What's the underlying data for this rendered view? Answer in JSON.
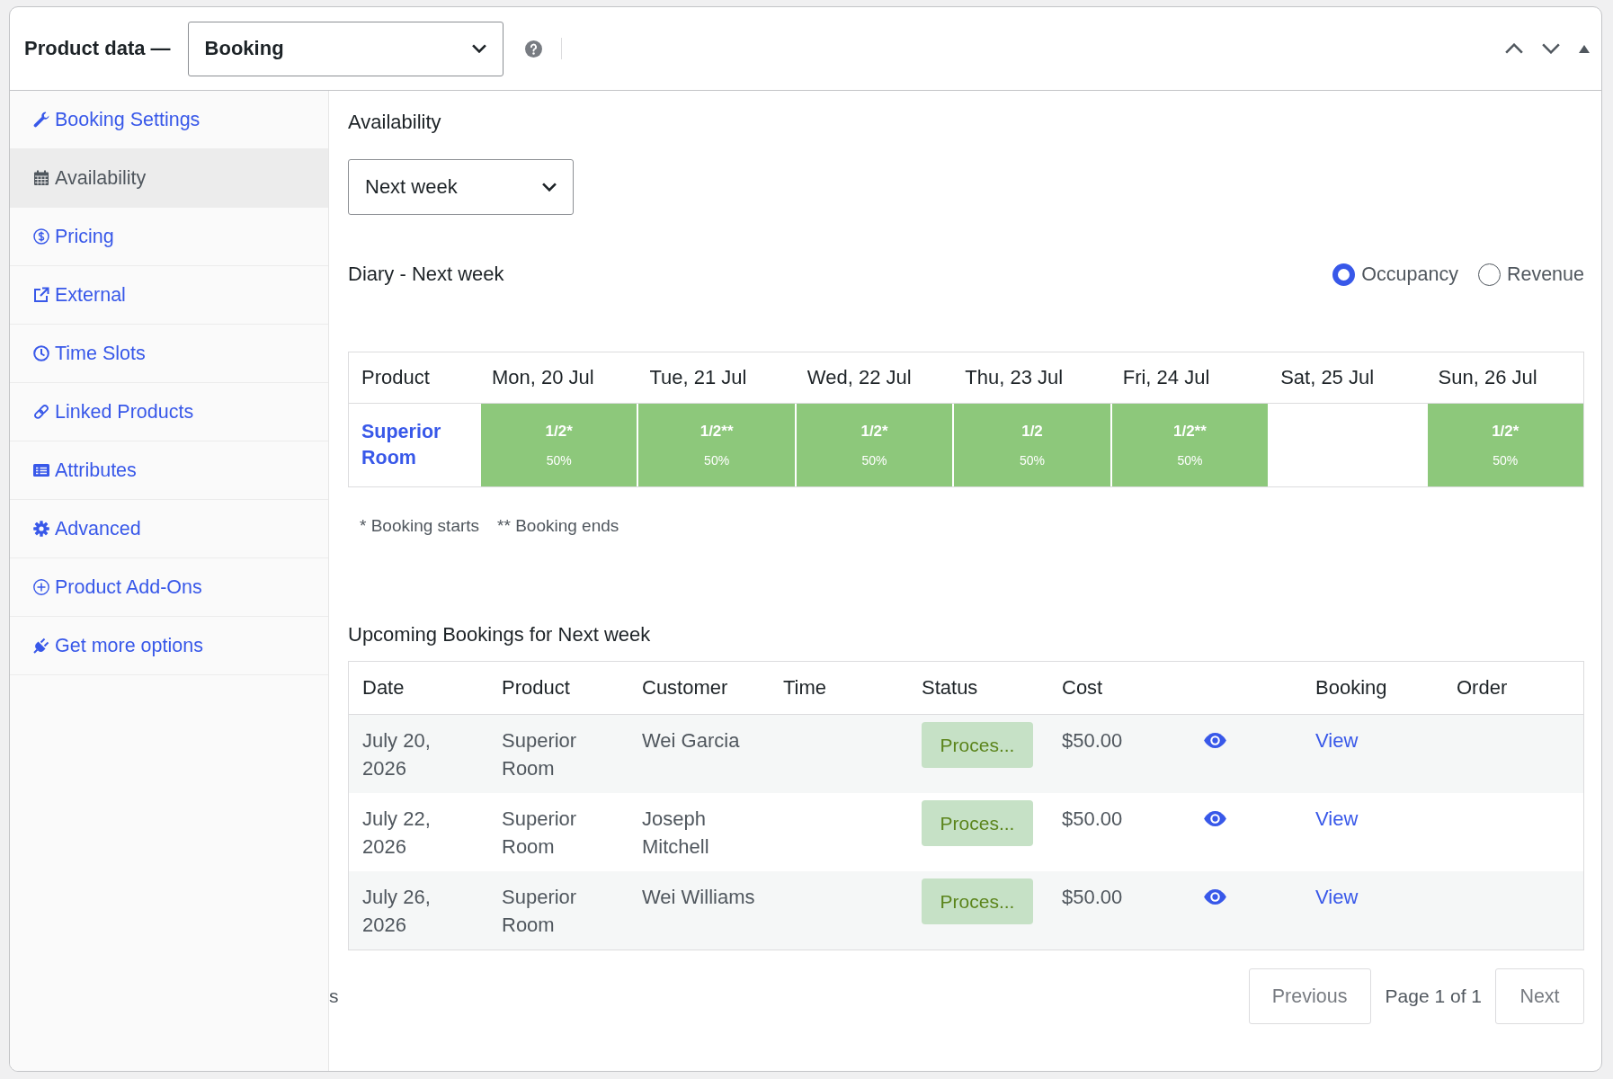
{
  "panel": {
    "title": "Product data —",
    "product_type_select": {
      "value": "Booking"
    }
  },
  "sidebar": {
    "items": [
      {
        "label": "Booking Settings",
        "selected": false
      },
      {
        "label": "Availability",
        "selected": true
      },
      {
        "label": "Pricing",
        "selected": false
      },
      {
        "label": "External",
        "selected": false
      },
      {
        "label": "Time Slots",
        "selected": false
      },
      {
        "label": "Linked Products",
        "selected": false
      },
      {
        "label": "Attributes",
        "selected": false
      },
      {
        "label": "Advanced",
        "selected": false
      },
      {
        "label": "Product Add-Ons",
        "selected": false
      },
      {
        "label": "Get more options",
        "selected": false
      }
    ]
  },
  "availability": {
    "heading": "Availability",
    "range_select": {
      "value": "Next week"
    },
    "diary": {
      "title": "Diary - Next week",
      "view_options": [
        {
          "label": "Occupancy",
          "selected": true
        },
        {
          "label": "Revenue",
          "selected": false
        }
      ],
      "columns": [
        "Product",
        "Mon, 20 Jul",
        "Tue, 21 Jul",
        "Wed, 22 Jul",
        "Thu, 23 Jul",
        "Fri, 24 Jul",
        "Sat, 25 Jul",
        "Sun, 26 Jul"
      ],
      "rows": [
        {
          "product": "Superior Room",
          "days": [
            {
              "booked": true,
              "count": "1/2*",
              "percent": "50%"
            },
            {
              "booked": true,
              "count": "1/2**",
              "percent": "50%"
            },
            {
              "booked": true,
              "count": "1/2*",
              "percent": "50%"
            },
            {
              "booked": true,
              "count": "1/2",
              "percent": "50%"
            },
            {
              "booked": true,
              "count": "1/2**",
              "percent": "50%"
            },
            {
              "booked": false
            },
            {
              "booked": true,
              "count": "1/2*",
              "percent": "50%"
            }
          ]
        }
      ],
      "legend": [
        "* Booking starts",
        "** Booking ends"
      ]
    },
    "upcoming": {
      "title": "Upcoming Bookings for Next week",
      "columns": [
        "Date",
        "Product",
        "Customer",
        "Time",
        "Status",
        "Cost",
        "Booking",
        "Order"
      ],
      "rows": [
        {
          "date": "July 20, 2026",
          "product": "Superior Room",
          "customer": "Wei Garcia",
          "status": "Proces...",
          "cost": "$50.00",
          "booking": "View"
        },
        {
          "date": "July 22, 2026",
          "product": "Superior Room",
          "customer": "Joseph Mitchell",
          "status": "Proces...",
          "cost": "$50.00",
          "booking": "View"
        },
        {
          "date": "July 26, 2026",
          "product": "Superior Room",
          "customer": "Wei Williams",
          "status": "Proces...",
          "cost": "$50.00",
          "booking": "View"
        }
      ],
      "pagination": {
        "previous": {
          "label": "Previous",
          "disabled": true
        },
        "page": "Page 1 of 1",
        "next": {
          "label": "Next",
          "disabled": true
        }
      }
    }
  },
  "clipped_text": "s"
}
